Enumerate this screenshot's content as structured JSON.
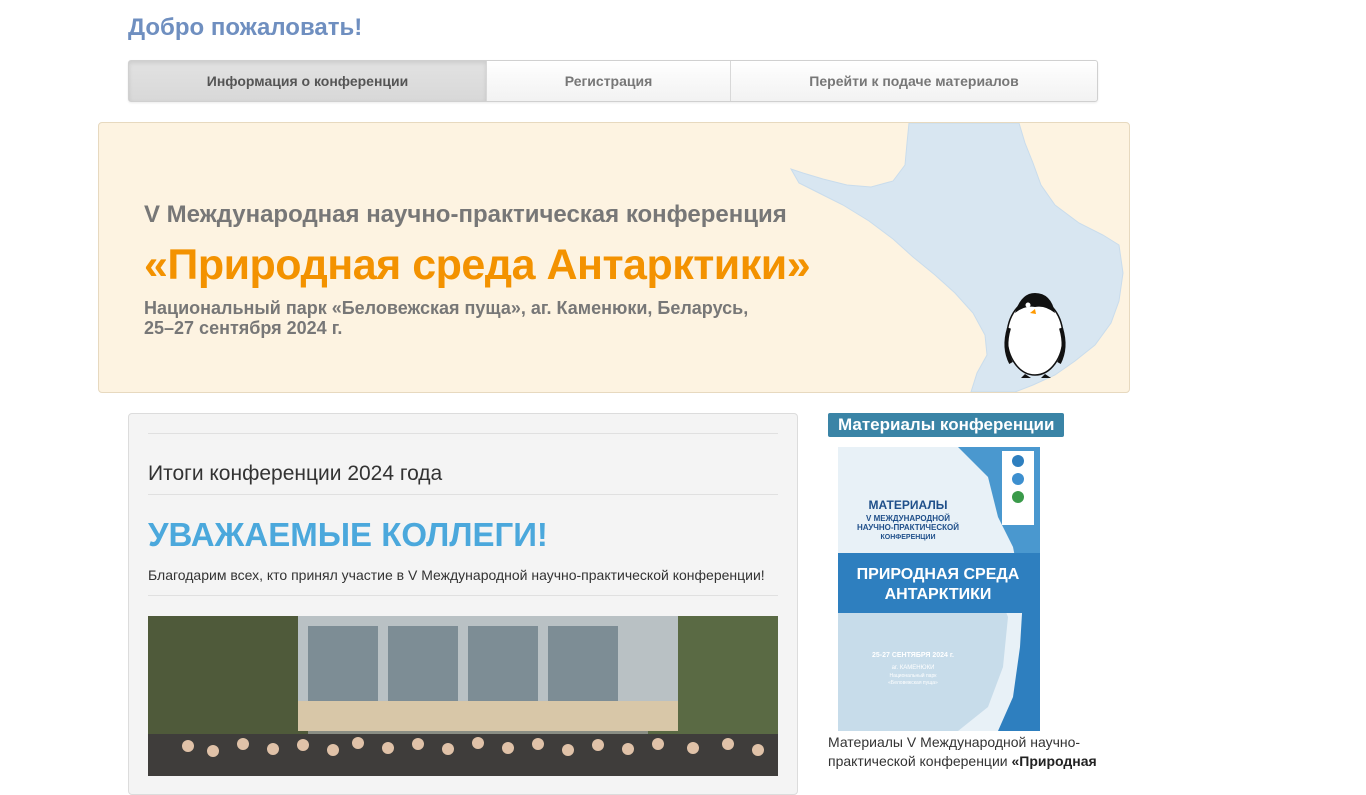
{
  "welcome": "Добро пожаловать!",
  "nav": {
    "items": [
      {
        "label": "Информация о конференции",
        "active": true
      },
      {
        "label": "Регистрация",
        "active": false
      },
      {
        "label": "Перейти к подаче материалов",
        "active": false
      }
    ]
  },
  "hero": {
    "subtitle": "V Международная научно-практическая конференция",
    "title": "«Природная среда Антарктики»",
    "place_line1": "Национальный парк «Беловежская пуща», аг. Каменюки, Беларусь,",
    "place_line2": "25–27 сентября 2024 г."
  },
  "main": {
    "results_heading": "Итоги конференции 2024 года",
    "colleagues": "УВАЖАЕМЫЕ КОЛЛЕГИ!",
    "thanks": "Благодарим всех, кто принял участие в V Международной научно-практической конференции!"
  },
  "sidebar": {
    "title": "Материалы конференции",
    "cover": {
      "line1": "МАТЕРИАЛЫ",
      "line2": "V МЕЖДУНАРОДНОЙ",
      "line3": "НАУЧНО-ПРАКТИЧЕСКОЙ",
      "line4": "КОНФЕРЕНЦИИ",
      "title1": "ПРИРОДНАЯ СРЕДА",
      "title2": "АНТАРКТИКИ",
      "date": "25-27 СЕНТЯБРЯ 2024 г.",
      "place1": "аг. КАМЕНЮКИ",
      "place2": "Национальный парк",
      "place3": "«Беловежская пуща»"
    },
    "text_plain": "Материалы V Международной научно-практической конференции ",
    "text_bold": "«Природная"
  },
  "colors": {
    "welcome": "#6f8fc0",
    "hero_bg": "#fdf3e1",
    "hero_title": "#f39200",
    "colleagues": "#4ba8dc",
    "sidebar_title_bg": "#3a84a6",
    "map_fill": "#d8e6f1"
  }
}
